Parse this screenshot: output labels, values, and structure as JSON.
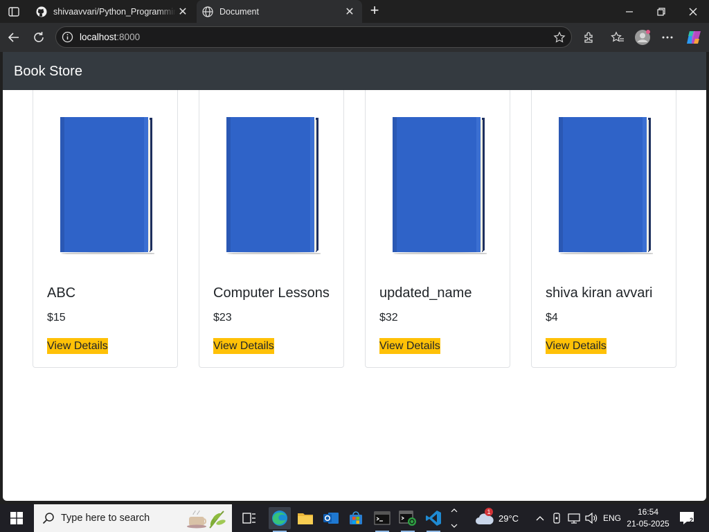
{
  "browser": {
    "tabs": [
      {
        "title": "shivaavvari/Python_Programming",
        "favicon": "github-icon",
        "active": false
      },
      {
        "title": "Document",
        "favicon": "globe-icon",
        "active": true
      }
    ],
    "address": {
      "host": "localhost",
      "port": ":8000"
    }
  },
  "site": {
    "brand": "Book Store",
    "books": [
      {
        "name": "ABC",
        "price": "$15",
        "button": "View Details"
      },
      {
        "name": "Computer Lessons",
        "price": "$23",
        "button": "View Details"
      },
      {
        "name": "updated_name",
        "price": "$32",
        "button": "View Details"
      },
      {
        "name": "shiva kiran avvari",
        "price": "$4",
        "button": "View Details"
      }
    ]
  },
  "taskbar": {
    "search_placeholder": "Type here to search",
    "weather": {
      "temp": "29°C",
      "badge": "1"
    },
    "language": "ENG",
    "time": "16:54",
    "date": "21-05-2025",
    "notification_count": "2"
  },
  "colors": {
    "navbar": "#343a40",
    "button": "#ffc107",
    "book_cover": "#2f63c8"
  }
}
